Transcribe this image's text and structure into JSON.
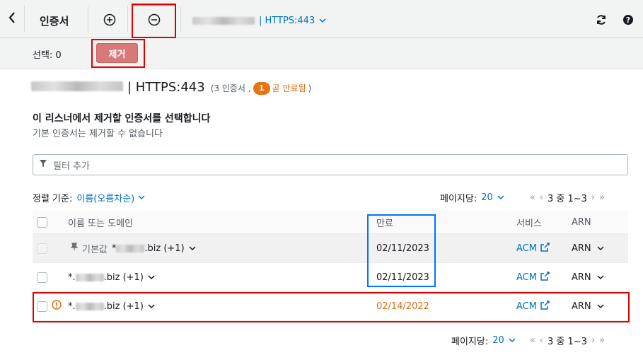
{
  "toolbar": {
    "back_icon": "chevron-left-icon",
    "title": "인증서",
    "add_icon": "plus-circle-icon",
    "remove_icon": "minus-circle-icon",
    "listener_suffix": "| HTTPS:443",
    "refresh_icon": "refresh-icon",
    "help_icon": "help-icon"
  },
  "subbar": {
    "selection": "선택: 0",
    "remove_label": "제거"
  },
  "header": {
    "listener": "| HTTPS:443",
    "cert_count_prefix": "(3 인증서 ,",
    "expiring_count": "1",
    "expiring_label": "곧 만료됨",
    "close_paren": ")"
  },
  "instructions": {
    "title": "이 리스너에서 제거할 인증서를 선택합니다",
    "subtitle": "기본 인증서는 제거할 수 없습니다"
  },
  "filter": {
    "placeholder": "필터 추가"
  },
  "sort": {
    "label": "정렬 기준:",
    "value": "이름(오름차순)"
  },
  "pagination": {
    "per_page_label": "페이지당:",
    "per_page": "20",
    "first": "«",
    "prev": "‹",
    "range": "3 중 1~3",
    "next": "›",
    "last": "»"
  },
  "table": {
    "headers": {
      "name": "이름 또는 도메인",
      "expiry": "만료",
      "service": "서비스",
      "arn": "ARN"
    },
    "rows": [
      {
        "default_label": "기본값",
        "name_prefix": "*",
        "name_suffix": ".biz (+1)",
        "expiry": "02/11/2023",
        "service": "ACM",
        "arn": "ARN"
      },
      {
        "name_prefix": "*.",
        "name_suffix": ".biz (+1)",
        "expiry": "02/11/2023",
        "service": "ACM",
        "arn": "ARN"
      },
      {
        "name_prefix": "*.",
        "name_suffix": ".biz (+1)",
        "expiry": "02/14/2022",
        "service": "ACM",
        "arn": "ARN"
      }
    ]
  },
  "colors": {
    "accent_link": "#0073bb",
    "warning": "#dd6b10",
    "highlight_red": "#e00000",
    "highlight_blue": "#0073ff"
  }
}
